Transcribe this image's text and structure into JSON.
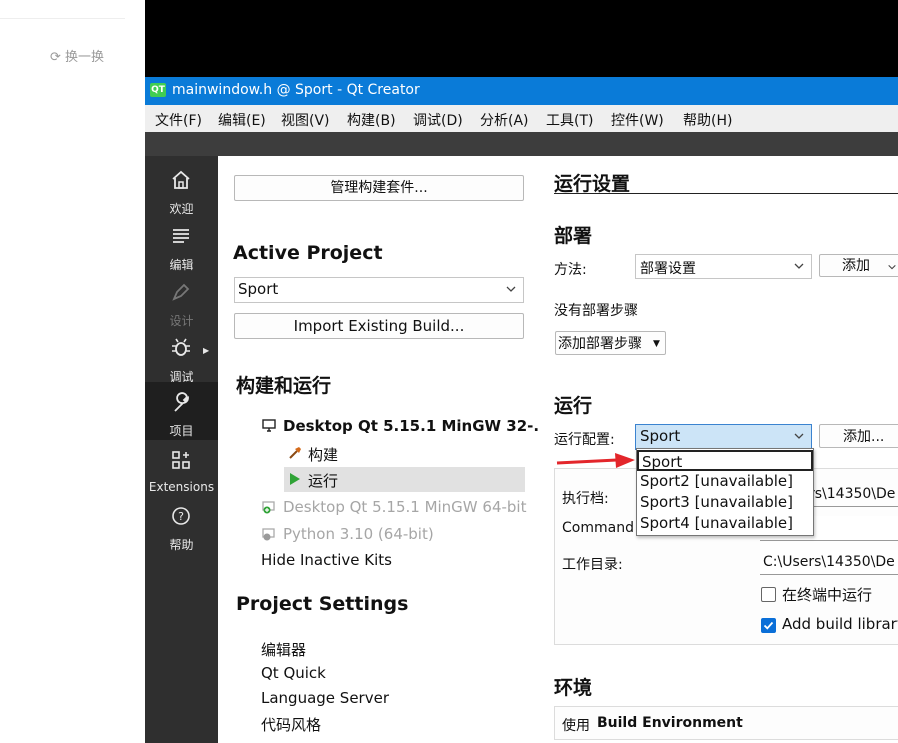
{
  "browser_side": {
    "refresh_label": "换一换"
  },
  "window": {
    "logo_text": "QT",
    "title": "mainwindow.h @ Sport - Qt Creator"
  },
  "menu": {
    "items": [
      "文件(F)",
      "编辑(E)",
      "视图(V)",
      "构建(B)",
      "调试(D)",
      "分析(A)",
      "工具(T)",
      "控件(W)",
      "帮助(H)"
    ]
  },
  "modes": {
    "welcome": "欢迎",
    "edit": "编辑",
    "design": "设计",
    "debug": "调试",
    "projects": "项目",
    "extensions": "Extensions",
    "help": "帮助"
  },
  "project": {
    "manage_kits_label": "管理构建套件...",
    "active_project_heading": "Active Project",
    "active_project_value": "Sport",
    "import_build_label": "Import Existing Build...",
    "build_run_heading": "构建和运行",
    "kit_active": "Desktop Qt 5.15.1 MinGW 32-...",
    "build_item": "构建",
    "run_item": "运行",
    "kit_inactive_1": "Desktop Qt 5.15.1 MinGW 64-bit",
    "kit_inactive_2": "Python 3.10 (64-bit)",
    "hide_inactive": "Hide Inactive Kits",
    "project_settings_heading": "Project Settings",
    "settings_items": [
      "编辑器",
      "Qt Quick",
      "Language Server",
      "代码风格"
    ]
  },
  "run_settings": {
    "heading": "运行设置",
    "deploy_heading": "部署",
    "method_label": "方法:",
    "method_value": "部署设置",
    "add_label": "添加",
    "no_deploy_steps": "没有部署步骤",
    "add_deploy_step": "添加部署步骤",
    "run_heading": "运行",
    "run_config_label": "运行配置:",
    "run_config_value": "Sport",
    "add_run_label": "添加...",
    "executable_label": "执行档:",
    "executable_value": "rs\\14350\\De",
    "command_args_label": "Command line arguments:",
    "working_dir_label": "工作目录:",
    "working_dir_value": "C:\\Users\\14350\\De",
    "run_in_terminal_label": "在终端中运行",
    "run_in_terminal_checked": false,
    "add_build_library_label": "Add build library",
    "add_build_library_checked": true,
    "env_heading": "环境",
    "env_use_prefix": "使用",
    "env_use_value": "Build Environment"
  },
  "dropdown": {
    "options": [
      "Sport",
      "Sport2 [unavailable]",
      "Sport3 [unavailable]",
      "Sport4 [unavailable]"
    ],
    "selected_index": 0
  },
  "annotation": {
    "arrow_color": "#e3262b"
  },
  "colors": {
    "titlebar": "#0a7bd8",
    "qt_green": "#41cd52",
    "run_selected_bg": "#e1e1e1",
    "combo_highlight": "#cce4f7",
    "checkbox_checked": "#0a6fd8"
  }
}
